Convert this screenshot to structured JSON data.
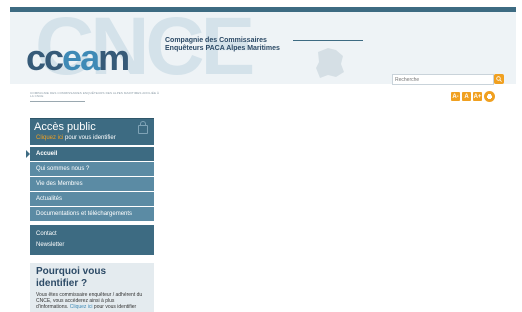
{
  "header": {
    "watermark": "CNCE",
    "logo_part1": "cc",
    "logo_part2": "ea",
    "logo_part3": "m",
    "org_title": "Compagnie des Commissaires Enquêteurs PACA Alpes Maritimes",
    "caption": "Compagnie des commissaires enquêteurs des Alpes Maritimes affiliée à la CNCE"
  },
  "search": {
    "placeholder": "Recherche"
  },
  "tools": [
    "A-",
    "A",
    "A+"
  ],
  "sidebar": {
    "access_title": "Accès public",
    "access_link": "Cliquez ici",
    "access_suffix": " pour vous identifier",
    "menu": [
      {
        "label": "Accueil"
      },
      {
        "label": "Qui sommes nous ?"
      },
      {
        "label": "Vie des Membres"
      },
      {
        "label": "Actualités"
      },
      {
        "label": "Documentations et téléchargements"
      }
    ],
    "menu2": [
      {
        "label": "Contact"
      },
      {
        "label": "Newsletter"
      }
    ],
    "why_title": "Pourquoi vous identifier ?",
    "why_text": "Vous êtes commissaire enquêteur / adhérent du CNCE, vous accéderez ainsi à plus d'informations.",
    "why_link": "Cliquez ici",
    "why_suffix": " pour vous identifier"
  },
  "colors": {
    "primary": "#3d6b82",
    "accent": "#f0a020",
    "menu": "#5b8ba4"
  }
}
